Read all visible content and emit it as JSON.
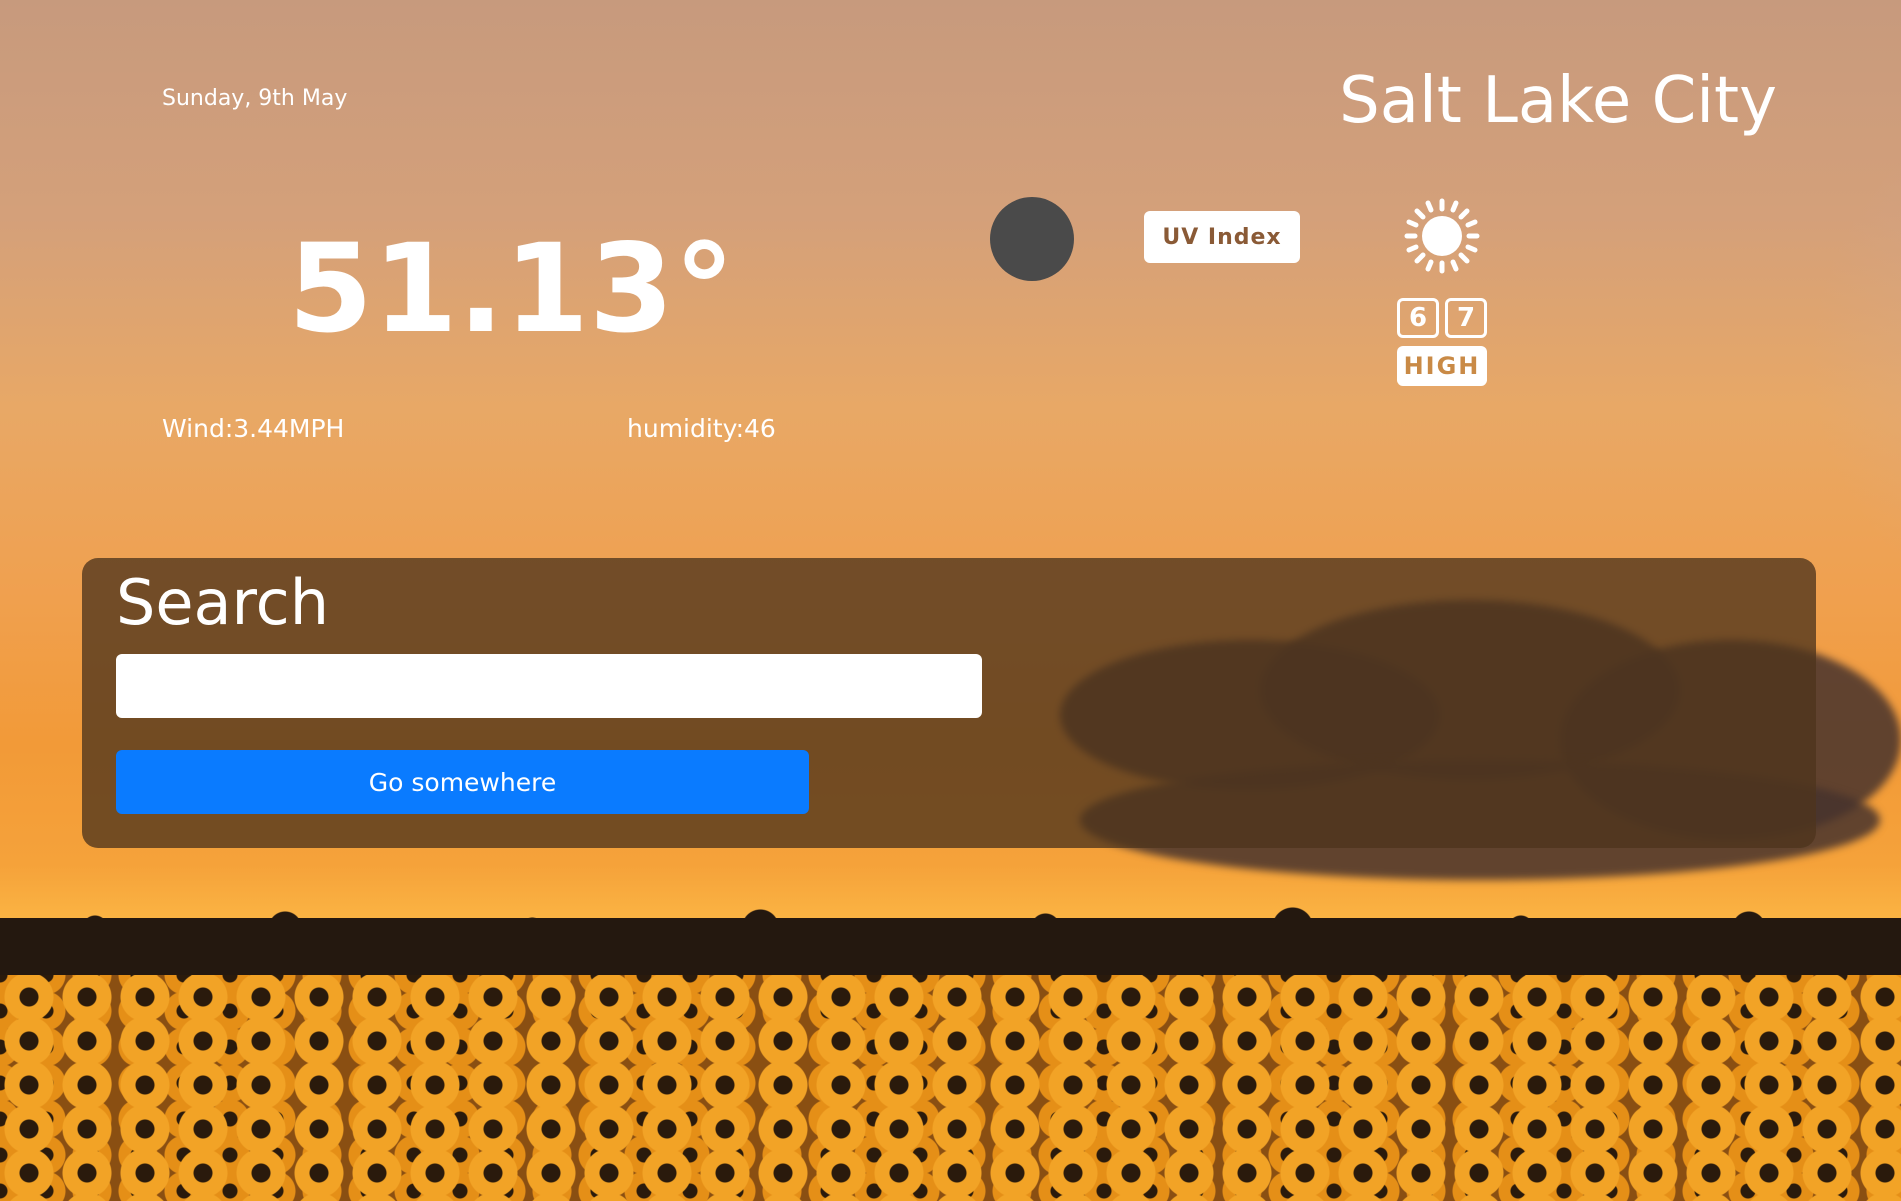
{
  "weather": {
    "date": "Sunday, 9th May",
    "city": "Salt Lake City",
    "temperature": "51.13°",
    "wind": "Wind:3.44MPH",
    "humidity": "humidity:46",
    "condition_icon": "dark-circle-icon"
  },
  "uv": {
    "badge_label": "UV Index",
    "digits": [
      "6",
      "7"
    ],
    "level": "HIGH",
    "icon": "sun-icon"
  },
  "search": {
    "title": "Search",
    "input_value": "",
    "input_placeholder": "",
    "button_label": "Go somewhere"
  },
  "colors": {
    "button_bg": "#0a7bff",
    "panel_bg": "rgba(78,52,28,0.78)",
    "text": "#ffffff"
  }
}
